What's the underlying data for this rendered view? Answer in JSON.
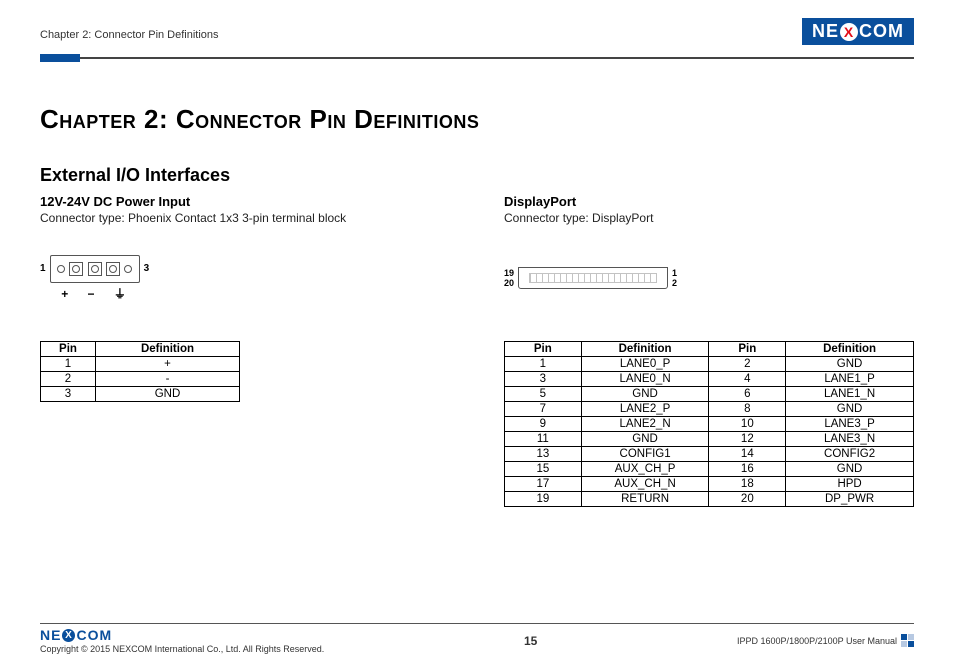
{
  "header": {
    "breadcrumb": "Chapter 2: Connector Pin Definitions",
    "logo_parts": {
      "pre": "NE",
      "x": "X",
      "post": "COM"
    }
  },
  "chapter_title": "Chapter 2: Connector Pin Definitions",
  "section_title": "External I/O Interfaces",
  "power": {
    "title": "12V-24V DC Power Input",
    "conn_type": "Connector type: Phoenix Contact 1x3 3-pin terminal block",
    "diagram": {
      "left_pin": "1",
      "right_pin": "3",
      "symbols": "+  −  ⏚"
    },
    "table": {
      "headers": [
        "Pin",
        "Definition"
      ],
      "rows": [
        [
          "1",
          "+"
        ],
        [
          "2",
          "-"
        ],
        [
          "3",
          "GND"
        ]
      ]
    }
  },
  "dp": {
    "title": "DisplayPort",
    "conn_type": "Connector type: DisplayPort",
    "diagram": {
      "tl": "19",
      "bl": "20",
      "tr": "1",
      "br": "2"
    },
    "table": {
      "headers": [
        "Pin",
        "Definition",
        "Pin",
        "Definition"
      ],
      "rows": [
        [
          "1",
          "LANE0_P",
          "2",
          "GND"
        ],
        [
          "3",
          "LANE0_N",
          "4",
          "LANE1_P"
        ],
        [
          "5",
          "GND",
          "6",
          "LANE1_N"
        ],
        [
          "7",
          "LANE2_P",
          "8",
          "GND"
        ],
        [
          "9",
          "LANE2_N",
          "10",
          "LANE3_P"
        ],
        [
          "11",
          "GND",
          "12",
          "LANE3_N"
        ],
        [
          "13",
          "CONFIG1",
          "14",
          "CONFIG2"
        ],
        [
          "15",
          "AUX_CH_P",
          "16",
          "GND"
        ],
        [
          "17",
          "AUX_CH_N",
          "18",
          "HPD"
        ],
        [
          "19",
          "RETURN",
          "20",
          "DP_PWR"
        ]
      ]
    }
  },
  "footer": {
    "copyright": "Copyright © 2015 NEXCOM International Co., Ltd. All Rights Reserved.",
    "page": "15",
    "manual": "IPPD 1600P/1800P/2100P User Manual"
  }
}
